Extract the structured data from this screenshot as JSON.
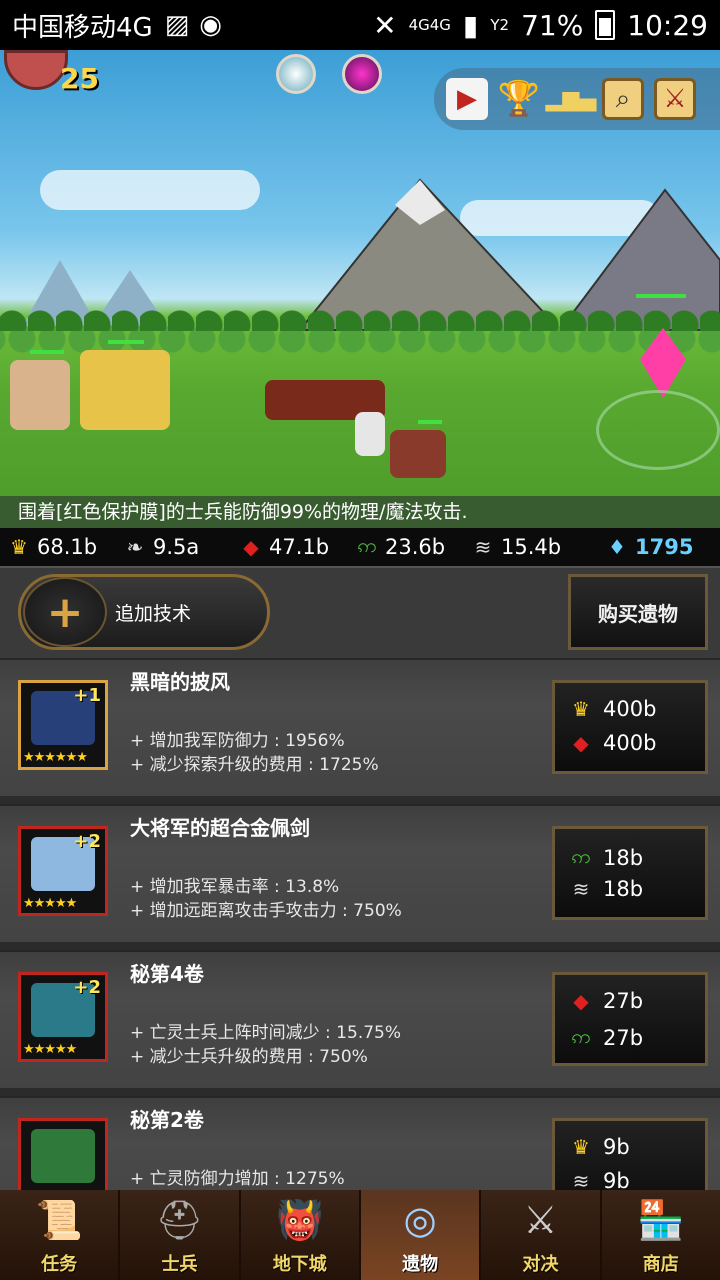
{
  "status_bar": {
    "carrier": "中国移动4G",
    "network": "4G4G",
    "sim": "Y2",
    "battery": "71%",
    "time": "10:29"
  },
  "player": {
    "level": "25"
  },
  "tip": "围着[红色保护膜]的士兵能防御99%的物理/魔法攻击.",
  "resources": [
    {
      "icon": "crown-icon",
      "value": "68.1b"
    },
    {
      "icon": "feather-icon",
      "value": "9.5a"
    },
    {
      "icon": "red-crystal-icon",
      "value": "47.1b"
    },
    {
      "icon": "green-vine-icon",
      "value": "23.6b"
    },
    {
      "icon": "claw-icon",
      "value": "15.4b"
    }
  ],
  "gems": "1795",
  "actions": {
    "add_tech": "追加技术",
    "buy_relic": "购买遗物"
  },
  "relics": [
    {
      "name": "黑暗的披风",
      "plus": "+1",
      "stars": "★★★★★★",
      "effects": [
        "+ 增加我军防御力 : 1956%",
        "+ 减少探索升级的费用 : 1725%"
      ],
      "costs": [
        {
          "icon": "crown-icon",
          "value": "400b"
        },
        {
          "icon": "red-crystal-icon",
          "value": "400b"
        }
      ],
      "border": "#d9a441",
      "pic_color": "#27407a"
    },
    {
      "name": "大将军的超合金佩剑",
      "plus": "+2",
      "stars": "★★★★★",
      "effects": [
        "+ 增加我军暴击率 : 13.8%",
        "+ 增加远距离攻击手攻击力 : 750%"
      ],
      "costs": [
        {
          "icon": "green-vine-icon",
          "value": "18b"
        },
        {
          "icon": "claw-icon",
          "value": "18b"
        }
      ],
      "border": "#c0261e",
      "pic_color": "#8fb8e0"
    },
    {
      "name": "秘第4卷",
      "plus": "+2",
      "stars": "★★★★★",
      "effects": [
        "+ 亡灵士兵上阵时间减少 : 15.75%",
        "+ 减少士兵升级的费用 : 750%"
      ],
      "costs": [
        {
          "icon": "red-crystal-icon",
          "value": "27b"
        },
        {
          "icon": "green-vine-icon",
          "value": "27b"
        }
      ],
      "border": "#c0261e",
      "pic_color": "#2a7a8a"
    },
    {
      "name": "秘第2卷",
      "plus": "",
      "stars": "",
      "effects": [
        "+ 亡灵防御力增加 : 1275%"
      ],
      "costs": [
        {
          "icon": "crown-icon",
          "value": "9b"
        },
        {
          "icon": "claw-icon",
          "value": "9b"
        }
      ],
      "border": "#c0261e",
      "pic_color": "#2f7a3a"
    }
  ],
  "nav": [
    {
      "label": "任务",
      "icon": "scroll-icon"
    },
    {
      "label": "士兵",
      "icon": "helmet-icon"
    },
    {
      "label": "地下城",
      "icon": "monster-icon"
    },
    {
      "label": "遗物",
      "icon": "orb-icon",
      "active": true
    },
    {
      "label": "对决",
      "icon": "crossed-swords-icon"
    },
    {
      "label": "商店",
      "icon": "shop-icon"
    }
  ]
}
